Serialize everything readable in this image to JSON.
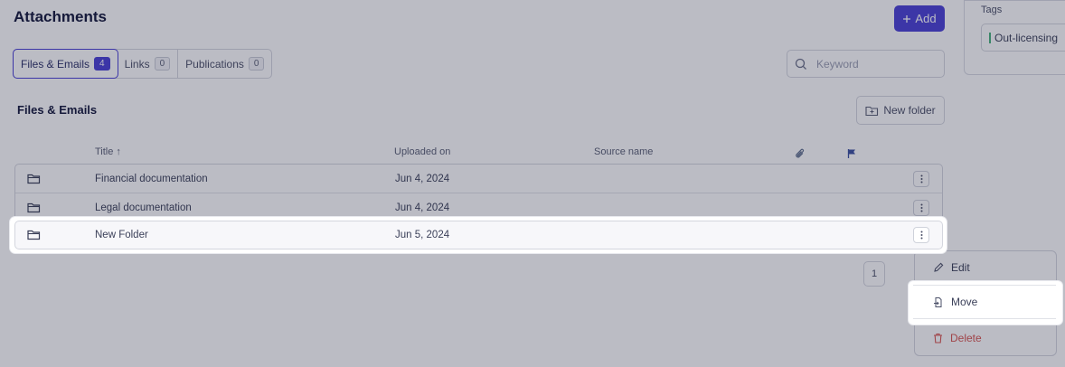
{
  "header": {
    "title": "Attachments",
    "add_label": "Add"
  },
  "tabs": [
    {
      "label": "Files & Emails",
      "count": "4"
    },
    {
      "label": "Links",
      "count": "0"
    },
    {
      "label": "Publications",
      "count": "0"
    }
  ],
  "search": {
    "placeholder": "Keyword"
  },
  "tags": {
    "label": "Tags",
    "chip": "Out-licensing"
  },
  "section": {
    "title": "Files & Emails",
    "new_folder_label": "New folder"
  },
  "table": {
    "columns": {
      "title": "Title",
      "title_sort": "↑",
      "uploaded": "Uploaded on",
      "source": "Source name"
    },
    "rows": [
      {
        "title": "Financial documentation",
        "uploaded": "Jun 4, 2024"
      },
      {
        "title": "Legal documentation",
        "uploaded": "Jun 4, 2024"
      },
      {
        "title": "New Folder",
        "uploaded": "Jun 5, 2024"
      }
    ]
  },
  "pagination": {
    "current": "1"
  },
  "menu": {
    "edit": "Edit",
    "move": "Move",
    "delete": "Delete"
  },
  "colors": {
    "accent": "#4a3fd6",
    "danger": "#d9534f",
    "tag_green": "#46b27a"
  }
}
